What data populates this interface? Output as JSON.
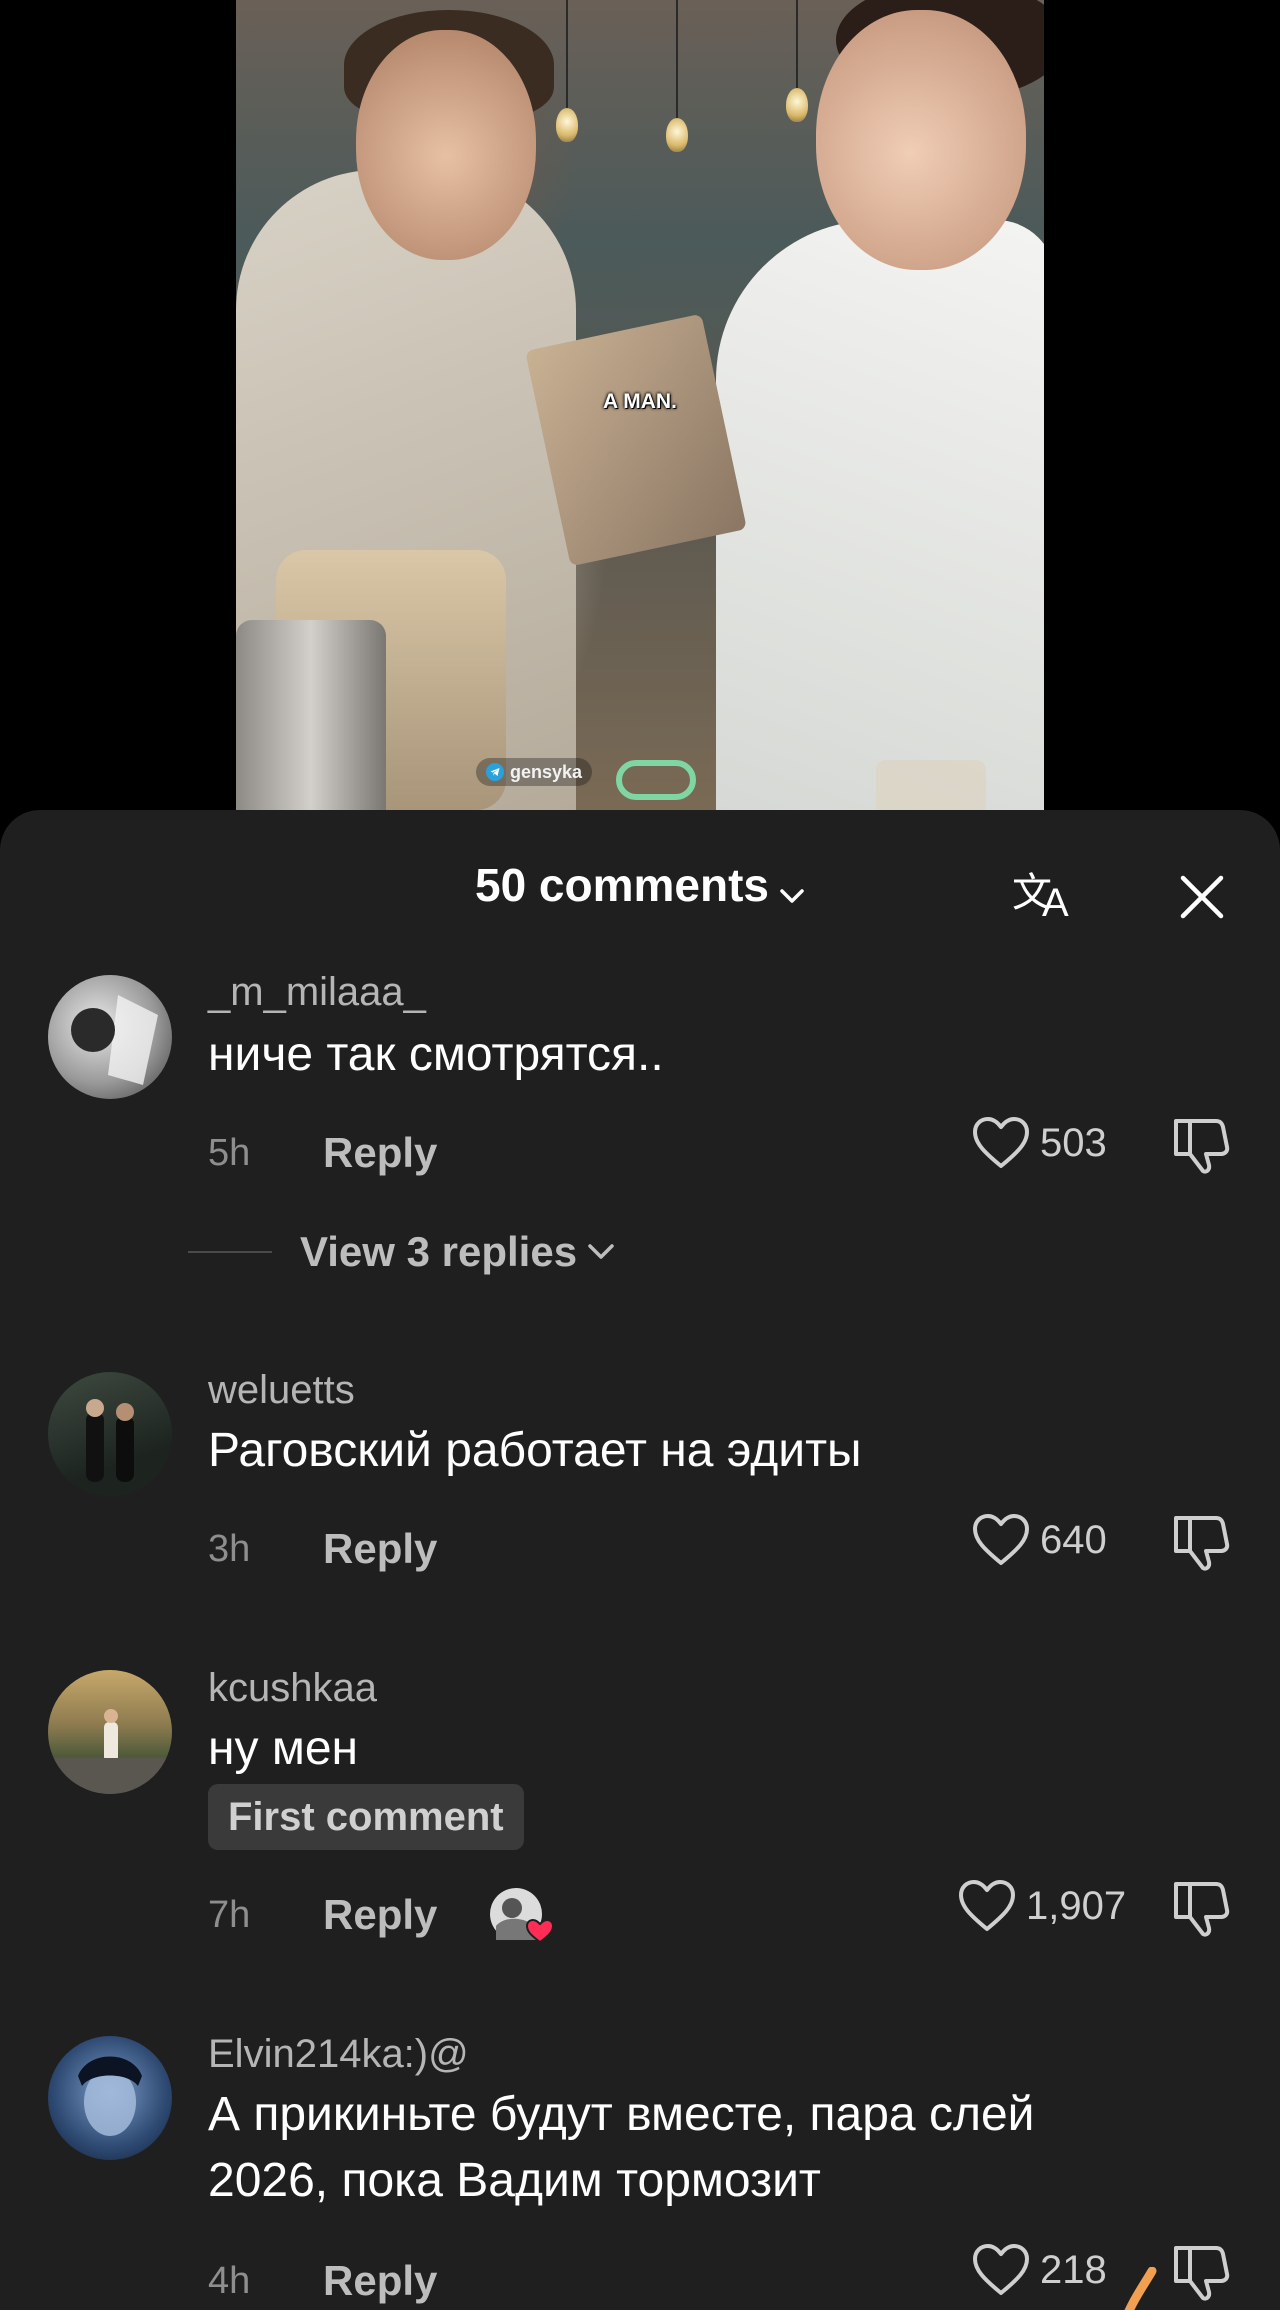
{
  "video": {
    "caption": "A MAN.",
    "watermark": "gensyka"
  },
  "sheet": {
    "title": "50 comments",
    "translate_icon": "translate-icon",
    "close_icon": "close-icon"
  },
  "comments": [
    {
      "username": "_m_milaaa_",
      "text": "ниче так смотрятся..",
      "time": "5h",
      "reply": "Reply",
      "likes": "503",
      "view_replies": "View 3 replies"
    },
    {
      "username": "weluetts",
      "text": "Раговский работает на эдиты",
      "time": "3h",
      "reply": "Reply",
      "likes": "640"
    },
    {
      "username": "kcushkaa",
      "text": "ну мен",
      "badge": "First comment",
      "time": "7h",
      "reply": "Reply",
      "likes": "1,907"
    },
    {
      "username": "Elvin214ka:)@",
      "text_line1": "А прикиньте будут вместе, пара слей",
      "text_line2": "2026, пока Вадим тормозит",
      "time": "4h",
      "reply": "Reply",
      "likes": "218"
    }
  ],
  "colors": {
    "sheet_bg": "#1f1f20",
    "badge_bg": "#3a3a3b",
    "secondary_text": "#b5b5b5",
    "brush_accent": "#f0a050"
  }
}
